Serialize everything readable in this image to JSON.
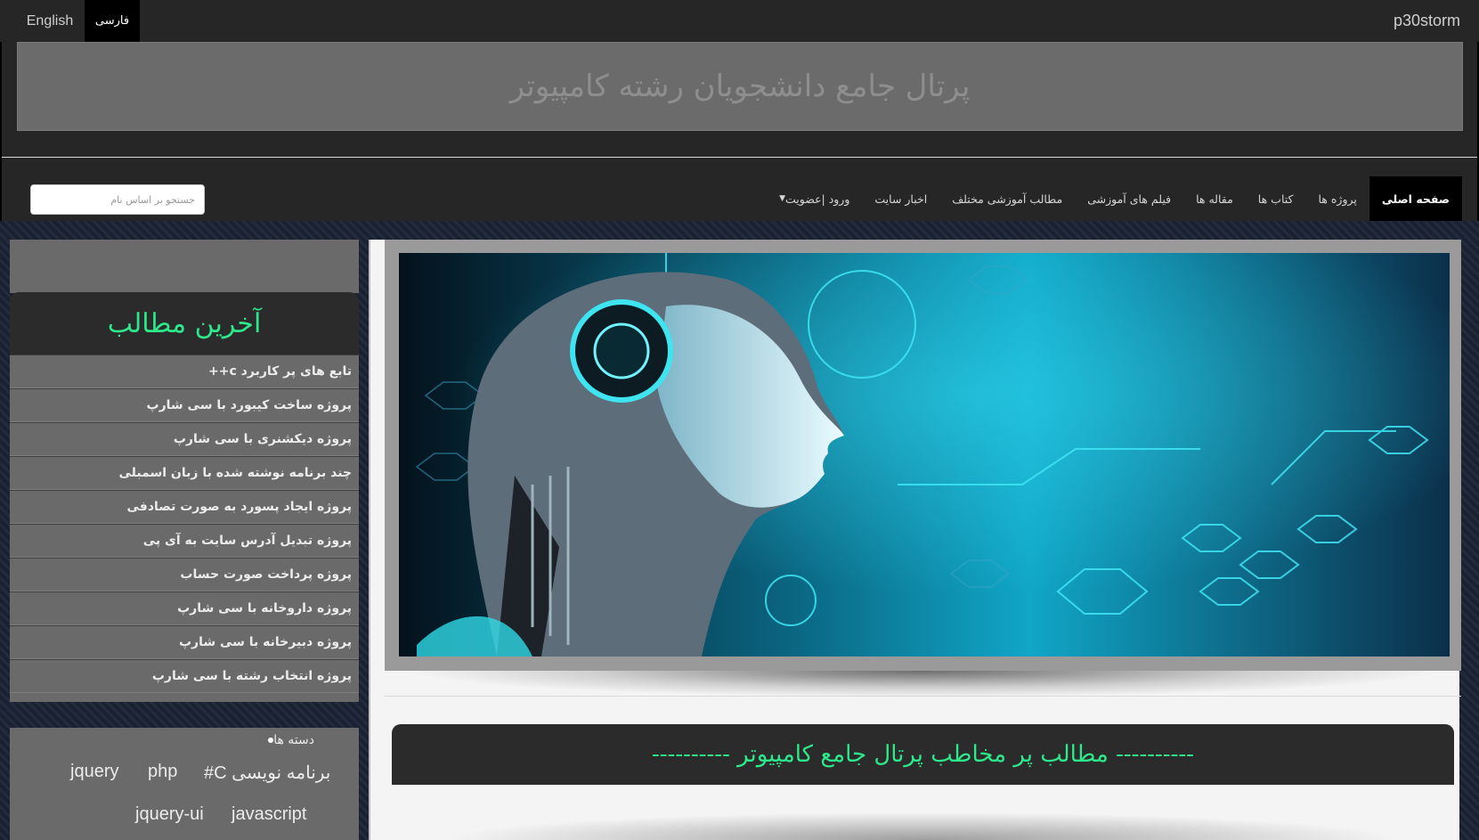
{
  "topbar": {
    "lang_english": "English",
    "lang_farsi": "فارسی",
    "brand": "p30storm"
  },
  "header": {
    "title": "پرتال جامع دانشجویان رشته کامپیوتر"
  },
  "nav": {
    "items": [
      {
        "label": "صفحه اصلی",
        "active": true
      },
      {
        "label": "پروژه ها"
      },
      {
        "label": "کتاب ها"
      },
      {
        "label": "مقاله ها"
      },
      {
        "label": "فیلم های آموزشی"
      },
      {
        "label": "مطالب آموزشی مختلف"
      },
      {
        "label": "اخبار سایت"
      },
      {
        "label": "ورود |عضویت"
      }
    ],
    "search_placeholder": "جستجو بر اساس نام"
  },
  "sidebar": {
    "latest_title": "آخرین مطالب",
    "latest_items": [
      "تابع های پر کاربرد c++",
      "پروژه ساخت کیبورد با سی شارپ",
      "پروژه دیکشنری با سی شارپ",
      "چند برنامه نوشته شده با زبان اسمبلی",
      "پروژه ایجاد پسورد به صورت تصادفی",
      "پروژه تبدیل آدرس سایت به آی پی",
      "پروژه پرداخت صورت حساب",
      "پروژه داروخانه با سی شارپ",
      "پروژه دبیرخانه با سی شارپ",
      "پروژه انتخاب رشته با سی شارپ"
    ],
    "categories_heading": "دسته ها",
    "tags": [
      "jquery",
      "php",
      "برنامه نویسی C#",
      "jquery-ui",
      "javascript"
    ]
  },
  "main": {
    "popular_title": "---------- مطالب پر مخاطب پرتال جامع کامپیوتر ----------"
  },
  "colors": {
    "accent_green": "#2ee88c",
    "bar_dark": "#262626",
    "panel_gray": "#6a6a6a"
  }
}
